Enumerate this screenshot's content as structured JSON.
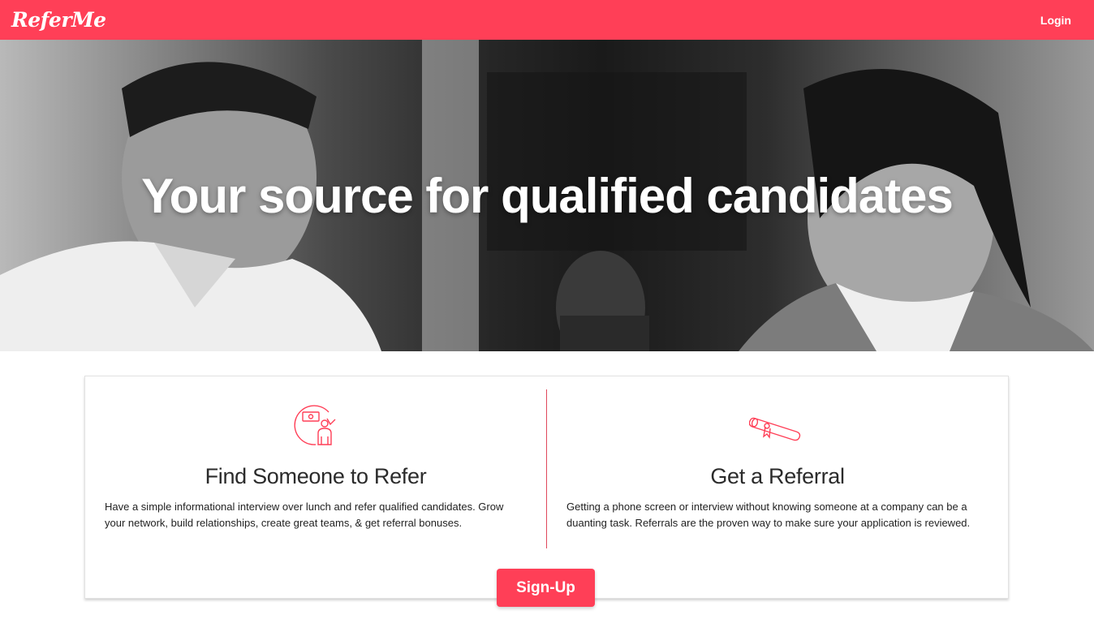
{
  "navbar": {
    "brand": "ReferMe",
    "login_label": "Login",
    "color": "#ff3f57"
  },
  "hero": {
    "title": "Your source for qualified candidates"
  },
  "features": [
    {
      "icon": "refer-person-icon",
      "title": "Find Someone to Refer",
      "description": "Have a simple informational interview over lunch and refer qualified candidates. Grow your network, build relationships, create great teams, & get referral bonuses."
    },
    {
      "icon": "diploma-scroll-icon",
      "title": "Get a Referral",
      "description": "Getting a phone screen or interview without knowing someone at a company can be a duanting task. Referrals are the proven way to make sure your application is reviewed."
    }
  ],
  "cta": {
    "signup_label": "Sign-Up"
  },
  "colors": {
    "accent": "#ff3f57",
    "divider": "#e0485c"
  }
}
